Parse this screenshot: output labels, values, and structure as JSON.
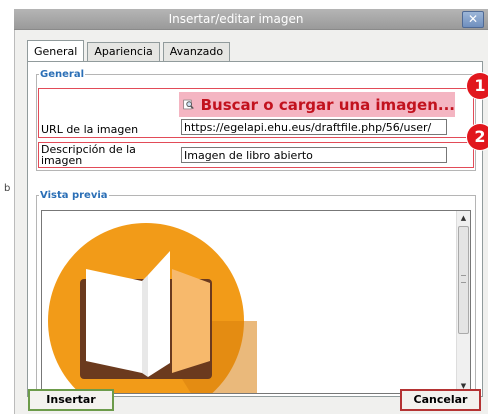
{
  "window": {
    "title": "Insertar/editar imagen",
    "close_glyph": "✕"
  },
  "tabs": [
    {
      "label": "General",
      "active": true
    },
    {
      "label": "Apariencia",
      "active": false
    },
    {
      "label": "Avanzado",
      "active": false
    }
  ],
  "general": {
    "legend": "General",
    "search_button": {
      "label": "Buscar o cargar una imagen...",
      "icon": "search-icon"
    },
    "url": {
      "label": "URL de la imagen",
      "value": "https://egelapi.ehu.eus/draftfile.php/56/user/"
    },
    "description": {
      "label": "Descripción de la imagen",
      "value": "Imagen de libro abierto"
    },
    "badges": [
      "1",
      "2"
    ]
  },
  "preview": {
    "legend": "Vista previa",
    "image": "open-book-icon",
    "scroll_up": "▲",
    "scroll_down": "▼"
  },
  "buttons": {
    "insert": "Insertar",
    "cancel": "Cancelar"
  },
  "stray_char": "b",
  "colors": {
    "legend": "#2b6fb6",
    "highlight": "#e24b58",
    "search_bg": "#f4b5c2",
    "search_text": "#c2121e",
    "badge": "#e1171d",
    "orange_circle": "#f29b18",
    "book_brown": "#6b3a1e"
  }
}
